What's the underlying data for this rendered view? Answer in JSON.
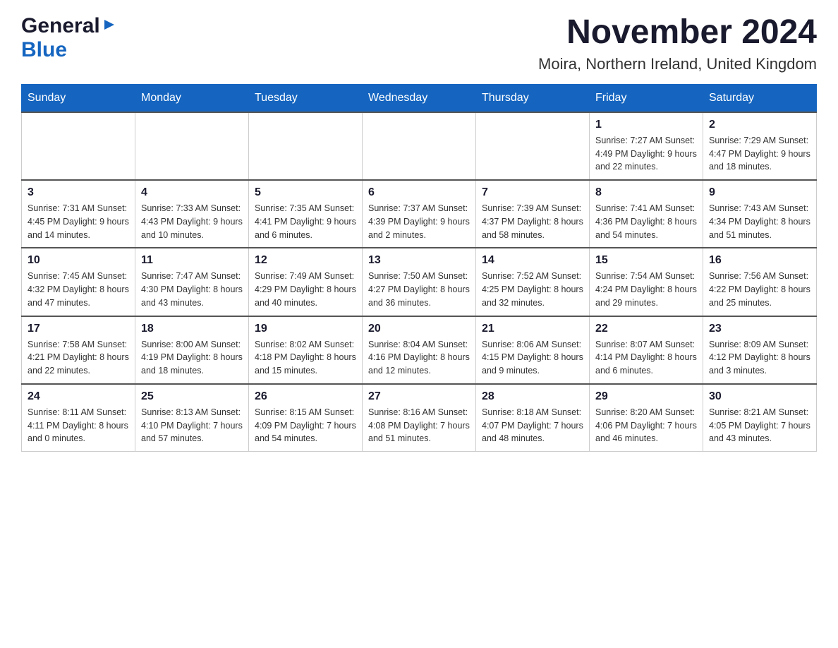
{
  "header": {
    "logo_general": "General",
    "logo_blue": "Blue",
    "month_title": "November 2024",
    "location": "Moira, Northern Ireland, United Kingdom"
  },
  "days_of_week": [
    "Sunday",
    "Monday",
    "Tuesday",
    "Wednesday",
    "Thursday",
    "Friday",
    "Saturday"
  ],
  "weeks": [
    [
      {
        "day": "",
        "info": ""
      },
      {
        "day": "",
        "info": ""
      },
      {
        "day": "",
        "info": ""
      },
      {
        "day": "",
        "info": ""
      },
      {
        "day": "",
        "info": ""
      },
      {
        "day": "1",
        "info": "Sunrise: 7:27 AM\nSunset: 4:49 PM\nDaylight: 9 hours\nand 22 minutes."
      },
      {
        "day": "2",
        "info": "Sunrise: 7:29 AM\nSunset: 4:47 PM\nDaylight: 9 hours\nand 18 minutes."
      }
    ],
    [
      {
        "day": "3",
        "info": "Sunrise: 7:31 AM\nSunset: 4:45 PM\nDaylight: 9 hours\nand 14 minutes."
      },
      {
        "day": "4",
        "info": "Sunrise: 7:33 AM\nSunset: 4:43 PM\nDaylight: 9 hours\nand 10 minutes."
      },
      {
        "day": "5",
        "info": "Sunrise: 7:35 AM\nSunset: 4:41 PM\nDaylight: 9 hours\nand 6 minutes."
      },
      {
        "day": "6",
        "info": "Sunrise: 7:37 AM\nSunset: 4:39 PM\nDaylight: 9 hours\nand 2 minutes."
      },
      {
        "day": "7",
        "info": "Sunrise: 7:39 AM\nSunset: 4:37 PM\nDaylight: 8 hours\nand 58 minutes."
      },
      {
        "day": "8",
        "info": "Sunrise: 7:41 AM\nSunset: 4:36 PM\nDaylight: 8 hours\nand 54 minutes."
      },
      {
        "day": "9",
        "info": "Sunrise: 7:43 AM\nSunset: 4:34 PM\nDaylight: 8 hours\nand 51 minutes."
      }
    ],
    [
      {
        "day": "10",
        "info": "Sunrise: 7:45 AM\nSunset: 4:32 PM\nDaylight: 8 hours\nand 47 minutes."
      },
      {
        "day": "11",
        "info": "Sunrise: 7:47 AM\nSunset: 4:30 PM\nDaylight: 8 hours\nand 43 minutes."
      },
      {
        "day": "12",
        "info": "Sunrise: 7:49 AM\nSunset: 4:29 PM\nDaylight: 8 hours\nand 40 minutes."
      },
      {
        "day": "13",
        "info": "Sunrise: 7:50 AM\nSunset: 4:27 PM\nDaylight: 8 hours\nand 36 minutes."
      },
      {
        "day": "14",
        "info": "Sunrise: 7:52 AM\nSunset: 4:25 PM\nDaylight: 8 hours\nand 32 minutes."
      },
      {
        "day": "15",
        "info": "Sunrise: 7:54 AM\nSunset: 4:24 PM\nDaylight: 8 hours\nand 29 minutes."
      },
      {
        "day": "16",
        "info": "Sunrise: 7:56 AM\nSunset: 4:22 PM\nDaylight: 8 hours\nand 25 minutes."
      }
    ],
    [
      {
        "day": "17",
        "info": "Sunrise: 7:58 AM\nSunset: 4:21 PM\nDaylight: 8 hours\nand 22 minutes."
      },
      {
        "day": "18",
        "info": "Sunrise: 8:00 AM\nSunset: 4:19 PM\nDaylight: 8 hours\nand 18 minutes."
      },
      {
        "day": "19",
        "info": "Sunrise: 8:02 AM\nSunset: 4:18 PM\nDaylight: 8 hours\nand 15 minutes."
      },
      {
        "day": "20",
        "info": "Sunrise: 8:04 AM\nSunset: 4:16 PM\nDaylight: 8 hours\nand 12 minutes."
      },
      {
        "day": "21",
        "info": "Sunrise: 8:06 AM\nSunset: 4:15 PM\nDaylight: 8 hours\nand 9 minutes."
      },
      {
        "day": "22",
        "info": "Sunrise: 8:07 AM\nSunset: 4:14 PM\nDaylight: 8 hours\nand 6 minutes."
      },
      {
        "day": "23",
        "info": "Sunrise: 8:09 AM\nSunset: 4:12 PM\nDaylight: 8 hours\nand 3 minutes."
      }
    ],
    [
      {
        "day": "24",
        "info": "Sunrise: 8:11 AM\nSunset: 4:11 PM\nDaylight: 8 hours\nand 0 minutes."
      },
      {
        "day": "25",
        "info": "Sunrise: 8:13 AM\nSunset: 4:10 PM\nDaylight: 7 hours\nand 57 minutes."
      },
      {
        "day": "26",
        "info": "Sunrise: 8:15 AM\nSunset: 4:09 PM\nDaylight: 7 hours\nand 54 minutes."
      },
      {
        "day": "27",
        "info": "Sunrise: 8:16 AM\nSunset: 4:08 PM\nDaylight: 7 hours\nand 51 minutes."
      },
      {
        "day": "28",
        "info": "Sunrise: 8:18 AM\nSunset: 4:07 PM\nDaylight: 7 hours\nand 48 minutes."
      },
      {
        "day": "29",
        "info": "Sunrise: 8:20 AM\nSunset: 4:06 PM\nDaylight: 7 hours\nand 46 minutes."
      },
      {
        "day": "30",
        "info": "Sunrise: 8:21 AM\nSunset: 4:05 PM\nDaylight: 7 hours\nand 43 minutes."
      }
    ]
  ]
}
